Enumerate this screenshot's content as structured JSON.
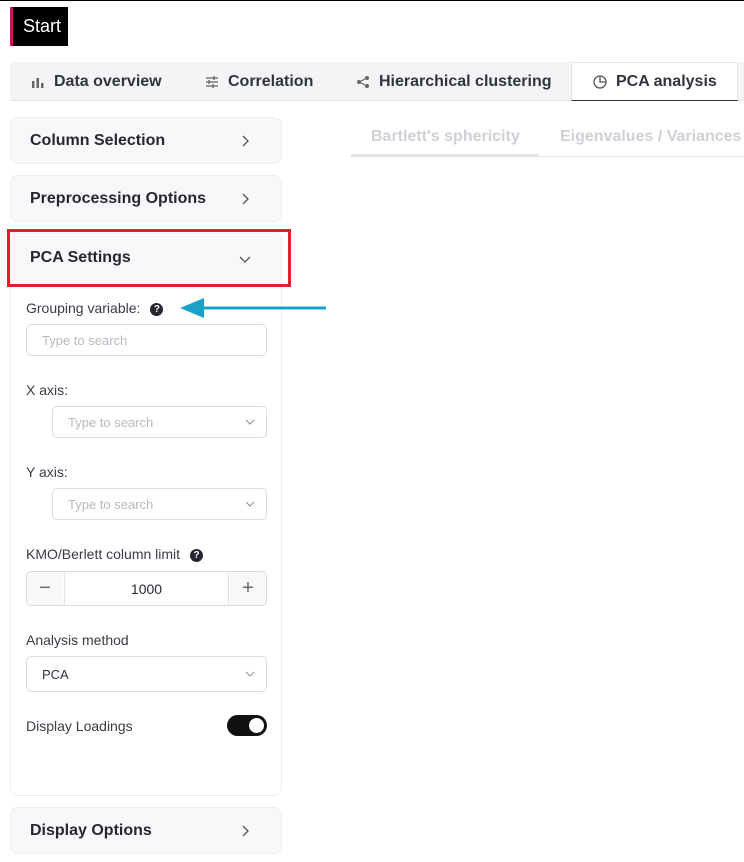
{
  "start_button": "Start",
  "tabs": [
    {
      "label": "Data overview",
      "icon": "bar-chart-icon"
    },
    {
      "label": "Correlation",
      "icon": "sliders-icon"
    },
    {
      "label": "Hierarchical clustering",
      "icon": "share-icon"
    },
    {
      "label": "PCA analysis",
      "icon": "pie-chart-icon",
      "active": true
    }
  ],
  "sidebar": {
    "column_selection": "Column Selection",
    "preprocessing": "Preprocessing Options",
    "pca_settings": "PCA Settings",
    "display_options": "Display Options"
  },
  "pca": {
    "grouping_label": "Grouping variable:",
    "grouping_placeholder": "Type to search",
    "x_axis_label": "X axis:",
    "x_axis_placeholder": "Type to search",
    "y_axis_label": "Y axis:",
    "y_axis_placeholder": "Type to search",
    "kmo_label": "KMO/Berlett column limit",
    "kmo_value": "1000",
    "method_label": "Analysis method",
    "method_value": "PCA",
    "loadings_label": "Display Loadings",
    "loadings_on": true
  },
  "subtabs": [
    "Bartlett's sphericity",
    "Eigenvalues / Variances"
  ],
  "colors": {
    "highlight": "#e0202a",
    "arrow": "#1aa3c9",
    "start_accent": "#c2185b"
  }
}
